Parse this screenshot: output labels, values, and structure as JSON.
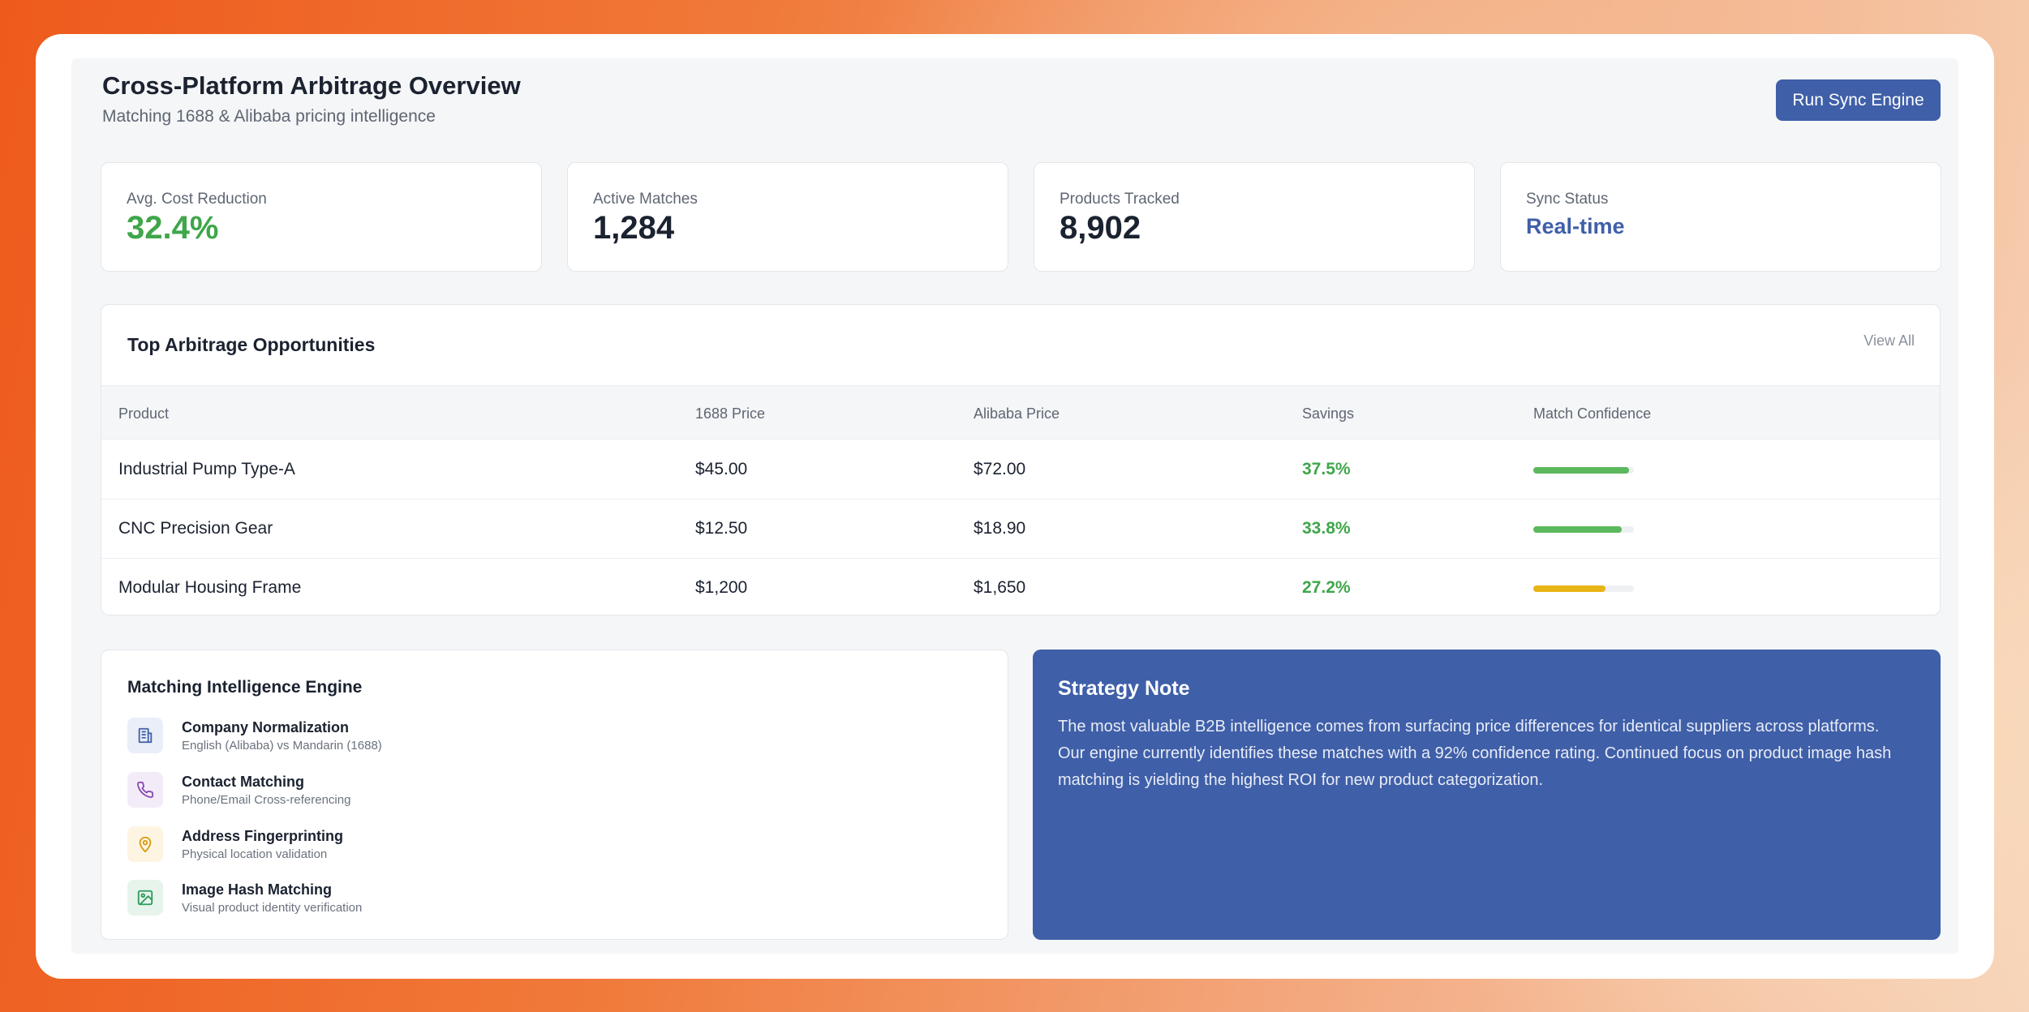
{
  "header": {
    "title": "Cross-Platform Arbitrage Overview",
    "subtitle": "Matching 1688 & Alibaba pricing intelligence",
    "run_button": "Run Sync Engine"
  },
  "stats": [
    {
      "label": "Avg. Cost Reduction",
      "value": "32.4%"
    },
    {
      "label": "Active Matches",
      "value": "1,284"
    },
    {
      "label": "Products Tracked",
      "value": "8,902"
    },
    {
      "label": "Sync Status",
      "value": "Real-time"
    }
  ],
  "opportunities": {
    "title": "Top Arbitrage Opportunities",
    "view_all": "View All",
    "columns": [
      "Product",
      "1688 Price",
      "Alibaba Price",
      "Savings",
      "Match Confidence"
    ],
    "rows": [
      {
        "product": "Industrial Pump Type-A",
        "price_1688": "$45.00",
        "price_alibaba": "$72.00",
        "savings": "37.5%",
        "confidence": 0.95
      },
      {
        "product": "CNC Precision Gear",
        "price_1688": "$12.50",
        "price_alibaba": "$18.90",
        "savings": "33.8%",
        "confidence": 0.88
      },
      {
        "product": "Modular Housing Frame",
        "price_1688": "$1,200",
        "price_alibaba": "$1,650",
        "savings": "27.2%",
        "confidence": 0.72
      }
    ]
  },
  "engine": {
    "title": "Matching Intelligence Engine",
    "features": [
      {
        "name": "Company Normalization",
        "desc": "English (Alibaba) vs Mandarin (1688)",
        "icon": "building-icon"
      },
      {
        "name": "Contact Matching",
        "desc": "Phone/Email Cross-referencing",
        "icon": "phone-icon"
      },
      {
        "name": "Address Fingerprinting",
        "desc": "Physical location validation",
        "icon": "map-pin-icon"
      },
      {
        "name": "Image Hash Matching",
        "desc": "Visual product identity verification",
        "icon": "image-icon"
      }
    ]
  },
  "note": {
    "title": "Strategy Note",
    "body": "The most valuable B2B intelligence comes from surfacing price differences for identical suppliers across platforms. Our engine currently identifies these matches with a 92% confidence rating. Continued focus on product image hash matching is yielding the highest ROI for new product categorization."
  },
  "colors": {
    "accent_blue": "#3f5fa8",
    "savings_green": "#3fa64a",
    "confidence_high": "#5cb85c",
    "confidence_mid": "#e9b516"
  }
}
